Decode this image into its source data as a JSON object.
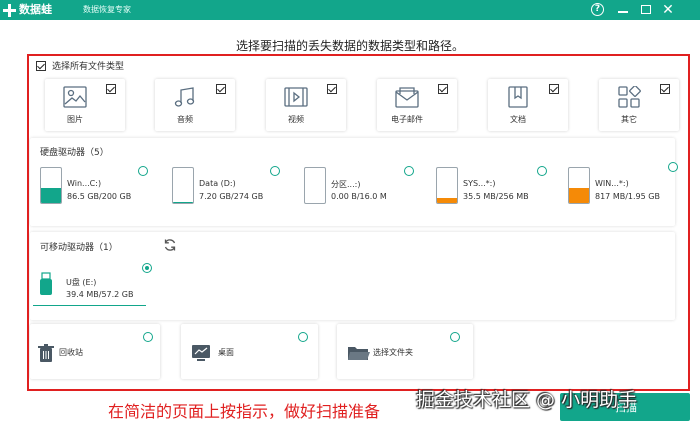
{
  "app": {
    "name": "数据蛙",
    "subtitle": "数据恢复专家"
  },
  "window_controls": {
    "help": "?",
    "close": "✕"
  },
  "heading": "选择要扫描的丢失数据的数据类型和路径。",
  "select_all": {
    "label": "选择所有文件类型",
    "checked": true
  },
  "file_types": [
    {
      "label": "图片",
      "icon": "image-icon",
      "checked": true
    },
    {
      "label": "音频",
      "icon": "audio-icon",
      "checked": true
    },
    {
      "label": "视频",
      "icon": "video-icon",
      "checked": true
    },
    {
      "label": "电子邮件",
      "icon": "email-icon",
      "checked": true
    },
    {
      "label": "文档",
      "icon": "document-icon",
      "checked": true
    },
    {
      "label": "其它",
      "icon": "other-icon",
      "checked": true
    }
  ],
  "hard_drives": {
    "title": "硬盘驱动器（5）",
    "items": [
      {
        "name": "Win...C:)",
        "size": "86.5 GB/200 GB",
        "used_fraction": 0.43,
        "color": "#12a68b"
      },
      {
        "name": "Data (D:)",
        "size": "7.20 GB/274 GB",
        "used_fraction": 0.03,
        "color": "#12a68b"
      },
      {
        "name": "分区...:)",
        "size": "0.00  B/16.0 M",
        "used_fraction": 0.0,
        "color": "#f5a623"
      },
      {
        "name": "SYS...*:)",
        "size": "35.5 MB/256 MB",
        "used_fraction": 0.14,
        "color": "#f58a07"
      },
      {
        "name": "WIN...*:)",
        "size": "817 MB/1.95 GB",
        "used_fraction": 0.42,
        "color": "#f58a07"
      }
    ]
  },
  "removable_drives": {
    "title": "可移动驱动器（1）",
    "items": [
      {
        "name": "U盘 (E:)",
        "size": "39.4 MB/57.2 GB",
        "selected": true
      }
    ]
  },
  "locations": [
    {
      "label": "回收站",
      "icon": "recycle-bin-icon"
    },
    {
      "label": "桌面",
      "icon": "desktop-icon"
    },
    {
      "label": "选择文件夹",
      "icon": "folder-icon"
    }
  ],
  "caption": "在简洁的页面上按指示，做好扫描准备",
  "scan_button": "扫描",
  "watermark": "掘金技术社区 @ 小明助手",
  "colors": {
    "accent": "#12a68b",
    "annotation": "#e02020",
    "warning": "#f58a07"
  }
}
